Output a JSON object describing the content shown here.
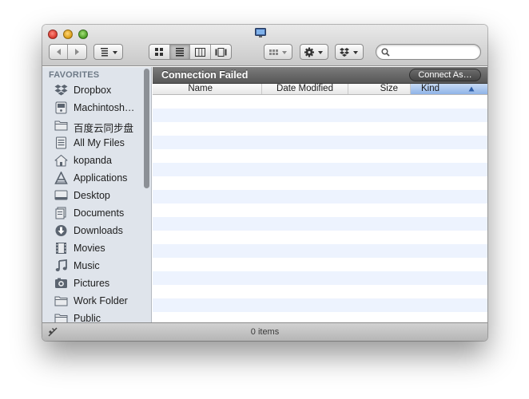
{
  "window": {
    "title_icon": "computer-monitor-icon"
  },
  "toolbar": {
    "back_icon": "back-arrow-icon",
    "forward_icon": "forward-arrow-icon",
    "arrange_icon": "arrange-icon",
    "view_icons": [
      "icon-view-icon",
      "list-view-icon",
      "column-view-icon",
      "coverflow-view-icon"
    ],
    "active_view": "list",
    "action_icon": "gear-icon",
    "dropbox_icon": "dropbox-icon",
    "search": {
      "value": "",
      "placeholder": ""
    }
  },
  "sidebar": {
    "header": "FAVORITES",
    "items": [
      {
        "label": "Dropbox",
        "icon": "dropbox-icon"
      },
      {
        "label": "Machintosh…",
        "icon": "hard-drive-icon"
      },
      {
        "label": "百度云同步盘",
        "icon": "folder-icon"
      },
      {
        "label": "All My Files",
        "icon": "all-files-icon"
      },
      {
        "label": "kopanda",
        "icon": "home-icon"
      },
      {
        "label": "Applications",
        "icon": "applications-icon"
      },
      {
        "label": "Desktop",
        "icon": "desktop-icon"
      },
      {
        "label": "Documents",
        "icon": "documents-icon"
      },
      {
        "label": "Downloads",
        "icon": "downloads-icon"
      },
      {
        "label": "Movies",
        "icon": "movies-icon"
      },
      {
        "label": "Music",
        "icon": "music-icon"
      },
      {
        "label": "Pictures",
        "icon": "pictures-icon"
      },
      {
        "label": "Work Folder",
        "icon": "folder-icon"
      },
      {
        "label": "Public",
        "icon": "folder-icon"
      }
    ]
  },
  "main": {
    "path_title": "Connection Failed",
    "connect_button": "Connect As…",
    "columns": [
      "Name",
      "Date Modified",
      "Size",
      "Kind"
    ],
    "sorted_column": "Kind",
    "sort_direction": "ascending"
  },
  "statusbar": {
    "text": "0 items",
    "icon": "network-disconnected-icon"
  },
  "colors": {
    "sidebar_bg": "#dfe4eb",
    "row_alt": "#edf3fe",
    "path_bar": "#676767",
    "sorted_column": "#a9c6ef"
  }
}
